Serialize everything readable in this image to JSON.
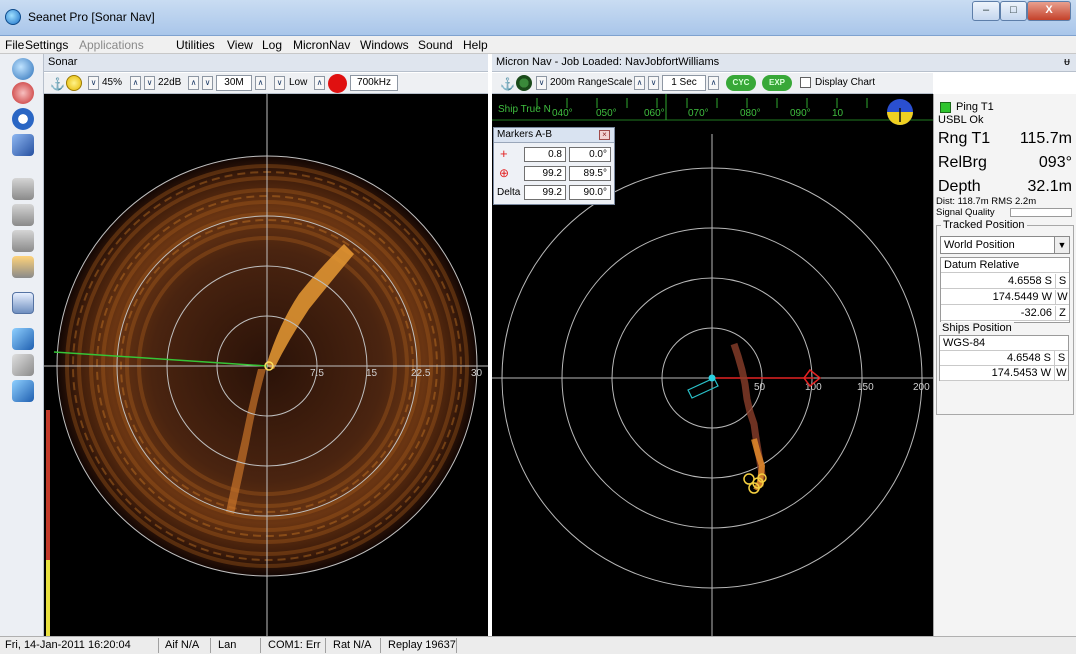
{
  "window": {
    "title": "Seanet Pro [Sonar Nav]",
    "min_label": "–",
    "max_label": "□",
    "close_label": "X"
  },
  "menu": [
    "File",
    "Settings",
    "Applications",
    "Utilities",
    "View",
    "Log",
    "MicronNav",
    "Windows",
    "Sound",
    "Help"
  ],
  "sonar": {
    "title": "Sonar",
    "toolbar": {
      "gain": "45%",
      "contrast": "22dB",
      "range": "30M",
      "mode": "Low",
      "frequency": "700kHz"
    },
    "range_labels": [
      "7.5",
      "15",
      "22.5",
      "30"
    ]
  },
  "nav": {
    "title": "Micron Nav - Job Loaded: NavJobfortWilliams",
    "pin_label": "ᵾ",
    "toolbar": {
      "range_scale": "200m RangeScale",
      "interval": "1 Sec",
      "cyc": "CYC",
      "exp": "EXP",
      "display_chart": "Display Chart"
    },
    "compass_label": "Ship True N",
    "compass_ticks": [
      "040°",
      "050°",
      "060°",
      "070°",
      "080°",
      "090°",
      "10"
    ],
    "range_labels": [
      "50",
      "100",
      "150",
      "200"
    ]
  },
  "markers": {
    "title": "Markers A-B",
    "rows": [
      {
        "label": "",
        "a": "0.8",
        "b": "0.0°"
      },
      {
        "label": "",
        "a": "99.2",
        "b": "89.5°"
      },
      {
        "label": "Delta",
        "a": "99.2",
        "b": "90.0°"
      }
    ]
  },
  "info": {
    "ping": "Ping T1",
    "usbl": "USBL Ok",
    "rng_label": "Rng T1",
    "rng_value": "115.7m",
    "relbrg_label": "RelBrg",
    "relbrg_value": "093°",
    "depth_label": "Depth",
    "depth_value": "32.1m",
    "dist": "Dist: 118.7m RMS 2.2m",
    "signal_quality": "Signal Quality",
    "tracked_title": "Tracked Position",
    "tracked_select": "World Position",
    "datum": "Datum Relative",
    "tracked_rows": [
      {
        "value": "4.6558 S",
        "unit": "S"
      },
      {
        "value": "174.5449 W",
        "unit": "W"
      },
      {
        "value": "-32.06",
        "unit": "Z"
      }
    ],
    "ships_title": "Ships Position",
    "ships_datum": "WGS-84",
    "ships_rows": [
      {
        "value": "4.6548 S",
        "unit": "S"
      },
      {
        "value": "174.5453 W",
        "unit": "W"
      }
    ]
  },
  "status": {
    "datetime": "Fri, 14-Jan-2011 16:20:04",
    "aif": "Aif N/A",
    "lan": "Lan",
    "com": "COM1: Err",
    "rat": "Rat N/A",
    "replay": "Replay 19637"
  },
  "colors": {
    "accent": "#2b6fc0",
    "sonar_warm": "#e07a1c",
    "marker_red": "#e32222",
    "compass_green": "#3fbf3f",
    "track": "#a85a3c"
  },
  "icons": [
    "app-icon",
    "anchor-icon",
    "record-icon",
    "close-icon",
    "chevron-down-icon",
    "dropdown-arrow-icon"
  ]
}
